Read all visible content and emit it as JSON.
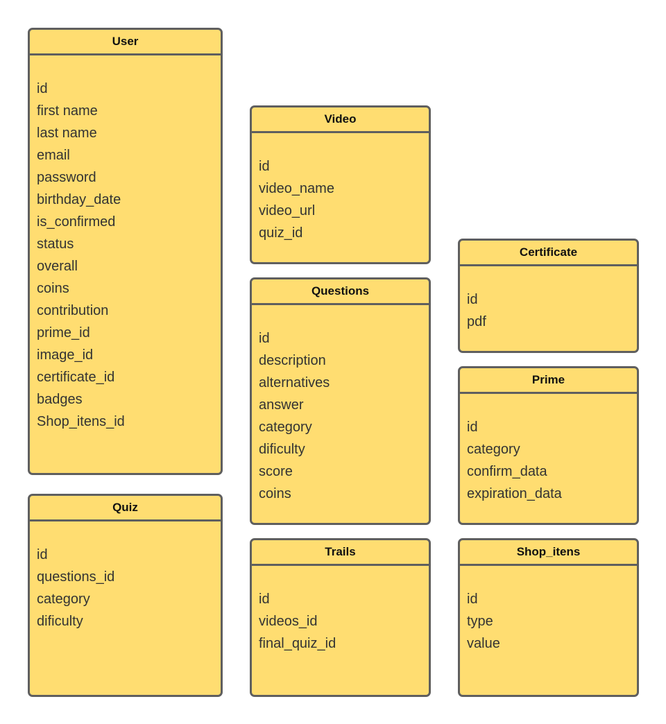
{
  "diagram": {
    "colors": {
      "fill": "#FFDD71",
      "border": "#5F5F5F",
      "text": "#333333"
    },
    "entities": [
      {
        "name": "User",
        "fields": [
          "id",
          "first name",
          "last name",
          "email",
          "password",
          "birthday_date",
          "is_confirmed",
          "status",
          "overall",
          "coins",
          "contribution",
          "prime_id",
          "image_id",
          "certificate_id",
          "badges",
          "Shop_itens_id"
        ]
      },
      {
        "name": "Quiz",
        "fields": [
          "id",
          "questions_id",
          "category",
          "dificulty"
        ]
      },
      {
        "name": "Video",
        "fields": [
          "id",
          "video_name",
          "video_url",
          "quiz_id"
        ]
      },
      {
        "name": "Questions",
        "fields": [
          "id",
          "description",
          "alternatives",
          "answer",
          "category",
          "dificulty",
          "score",
          "coins"
        ]
      },
      {
        "name": "Trails",
        "fields": [
          "id",
          "videos_id",
          "final_quiz_id"
        ]
      },
      {
        "name": "Certificate",
        "fields": [
          "id",
          "pdf"
        ]
      },
      {
        "name": "Prime",
        "fields": [
          "id",
          "category",
          "confirm_data",
          "expiration_data"
        ]
      },
      {
        "name": "Shop_itens",
        "fields": [
          "id",
          "type",
          "value"
        ]
      }
    ]
  }
}
